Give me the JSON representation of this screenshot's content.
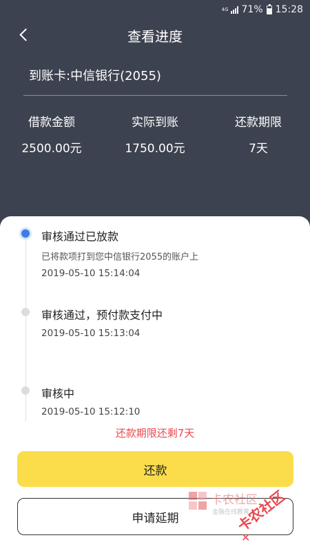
{
  "status_bar": {
    "network": "4G",
    "battery": "71%",
    "battery_level": 0.71,
    "time": "15:28"
  },
  "nav": {
    "title": "查看进度"
  },
  "card": {
    "text": "到账卡:中信银行(2055)"
  },
  "stats": [
    {
      "label": "借款金额",
      "value": "2500.00元"
    },
    {
      "label": "实际到账",
      "value": "1750.00元"
    },
    {
      "label": "还款期限",
      "value": "7天"
    }
  ],
  "timeline": [
    {
      "title": "审核通过已放款",
      "desc": "已将款项打到您中信银行2055的账户上",
      "time": "2019-05-10 15:14:04",
      "active": true
    },
    {
      "title": "审核通过，预付款支付中",
      "desc": "",
      "time": "2019-05-10 15:13:04",
      "active": false
    },
    {
      "title": "审核中",
      "desc": "",
      "time": "2019-05-10 15:12:10",
      "active": false
    }
  ],
  "remaining": "还款期限还剩7天",
  "buttons": {
    "repay": "还款",
    "extend": "申请延期"
  },
  "watermark": {
    "main": "卡农社区",
    "sub": "金融在线教育"
  },
  "colors": {
    "header_bg": "#3d4250",
    "primary": "#fbdd4c",
    "accent_red": "#e8474e",
    "active_dot": "#3c7ee6"
  }
}
